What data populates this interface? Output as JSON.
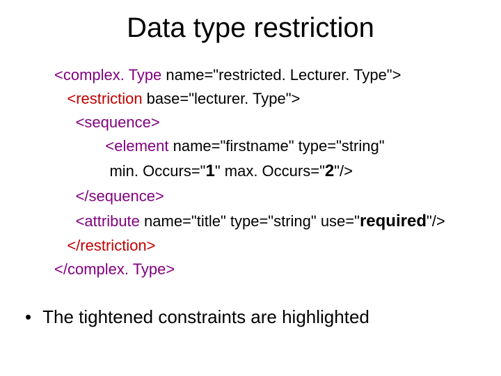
{
  "title": "Data type restriction",
  "code": {
    "l1a": "<complex. Type ",
    "l1b": "name=\"restricted. Lecturer. Type\">",
    "l2a": "<restriction ",
    "l2b": "base=\"lecturer. Type\">",
    "l3": "<sequence>",
    "l4a": "<element ",
    "l4b": "name=\"firstname\" type=\"string\"",
    "l5a": "min. Occurs=\"",
    "l5b": "1",
    "l5c": "\" max. Occurs=\"",
    "l5d": "2",
    "l5e": "\"/>",
    "l6": "</sequence>",
    "l7a": "<attribute ",
    "l7b": "name=\"title\" type=\"string\" use=\"",
    "l7c": "required",
    "l7d": "\"/>",
    "l8": "</restriction>",
    "l9": "</complex. Type>"
  },
  "bullet": "The tightened constraints are highlighted"
}
